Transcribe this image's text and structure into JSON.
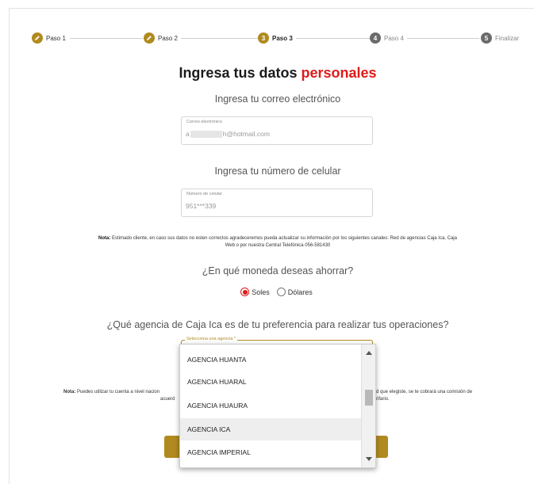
{
  "stepper": {
    "steps": [
      {
        "label": "Paso 1",
        "number": "",
        "state": "done"
      },
      {
        "label": "Paso 2",
        "number": "",
        "state": "done"
      },
      {
        "label": "Paso 3",
        "number": "3",
        "state": "active"
      },
      {
        "label": "Paso 4",
        "number": "4",
        "state": "todo"
      },
      {
        "label": "Finalizar",
        "number": "5",
        "state": "todo"
      }
    ],
    "colors": {
      "done": "#b08a1f",
      "todo": "#6b6b6b"
    }
  },
  "title": {
    "main": "Ingresa tus datos",
    "accent": "personales",
    "accent_color": "#e01b1b"
  },
  "email": {
    "heading": "Ingresa tu correo electrónico",
    "label": "Correo electrónico",
    "value_prefix": "a",
    "value_suffix": "h@hotmail.com"
  },
  "phone": {
    "heading": "Ingresa tu número de celular",
    "label": "Número de celular",
    "value": "951***339"
  },
  "note1": {
    "bold": "Nota:",
    "line1": "Estimado cliente, en caso sus datos no esten correctos agradeceremos pueda actualizar su información por los siguientes canales: Red de agencias Caja Ica, Caja",
    "line2": "Web o por nuestra Central Telefónica 056-581430"
  },
  "currency": {
    "heading": "¿En qué moneda deseas ahorrar?",
    "options": [
      "Soles",
      "Dólares"
    ],
    "selected": "Soles"
  },
  "agency": {
    "heading": "¿Qué agencia de Caja Ica es de tu preferencia para realizar tus operaciones?",
    "label": "Selecciona una agencia *",
    "options": [
      "AGENCIA HUANTA",
      "AGENCIA HUARAL",
      "AGENCIA HUAURA",
      "AGENCIA ICA",
      "AGENCIA IMPERIAL"
    ],
    "hovered": "AGENCIA ICA"
  },
  "note2": {
    "bold": "Nota:",
    "left_line1": "Puedes utilizar tu cuenta a nivel nacion",
    "left_line2": "acuerd",
    "right_line1": "d que elegiste, se te cobrará una comisión de",
    "right_line2": "rifario."
  },
  "accent_color": "#b08a1f"
}
